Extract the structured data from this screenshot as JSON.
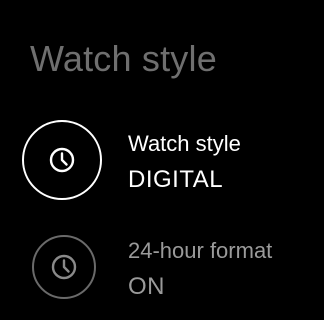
{
  "page": {
    "title": "Watch style"
  },
  "settings": [
    {
      "icon": "clock-icon",
      "title": "Watch style",
      "value": "DIGITAL",
      "selected": true
    },
    {
      "icon": "clock-icon",
      "title": "24-hour format",
      "value": "ON",
      "selected": false
    }
  ],
  "colors": {
    "background": "#000000",
    "title": "#6f6f6f",
    "active_text": "#ffffff",
    "inactive_text": "#9a9a9a",
    "inactive_ring": "#6a6a6a"
  }
}
